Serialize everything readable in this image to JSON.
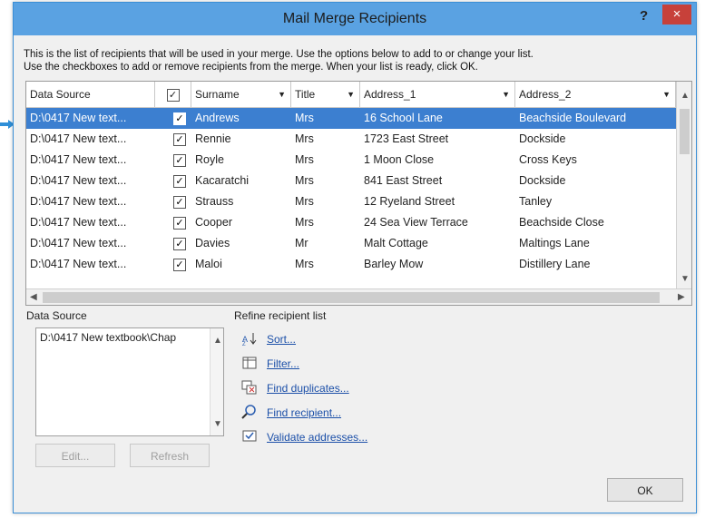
{
  "window": {
    "title": "Mail Merge Recipients",
    "help": "?",
    "close": "×"
  },
  "instructions": {
    "line1": "This is the list of recipients that will be used in your merge.  Use the options below to add to or change your list.",
    "line2": "Use the checkboxes to add or remove recipients from the merge.  When your list is ready, click OK."
  },
  "table": {
    "headers": [
      "Data Source",
      "✓",
      "Surname",
      "Title",
      "Address_1",
      "Address_2"
    ],
    "rows": [
      {
        "source": "D:\\0417 New text...",
        "checked": "✓",
        "surname": "Andrews",
        "title": "Mrs",
        "address1": "16 School Lane",
        "address2": "Beachside Boulevard",
        "selected": true
      },
      {
        "source": "D:\\0417 New text...",
        "checked": "✓",
        "surname": "Rennie",
        "title": "Mrs",
        "address1": "1723 East Street",
        "address2": "Dockside"
      },
      {
        "source": "D:\\0417 New text...",
        "checked": "✓",
        "surname": "Royle",
        "title": "Mrs",
        "address1": "1 Moon Close",
        "address2": "Cross Keys"
      },
      {
        "source": "D:\\0417 New text...",
        "checked": "✓",
        "surname": "Kacaratchi",
        "title": "Mrs",
        "address1": "841 East Street",
        "address2": "Dockside"
      },
      {
        "source": "D:\\0417 New text...",
        "checked": "✓",
        "surname": "Strauss",
        "title": "Mrs",
        "address1": "12 Ryeland Street",
        "address2": "Tanley"
      },
      {
        "source": "D:\\0417 New text...",
        "checked": "✓",
        "surname": "Cooper",
        "title": "Mrs",
        "address1": "24 Sea View Terrace",
        "address2": "Beachside Close"
      },
      {
        "source": "D:\\0417 New text...",
        "checked": "✓",
        "surname": "Davies",
        "title": "Mr",
        "address1": "Malt Cottage",
        "address2": "Maltings Lane"
      },
      {
        "source": "D:\\0417 New text...",
        "checked": "✓",
        "surname": "Maloi",
        "title": "Mrs",
        "address1": "Barley Mow",
        "address2": "Distillery Lane"
      }
    ]
  },
  "data_source": {
    "label": "Data Source",
    "value": "D:\\0417 New textbook\\Chap",
    "edit_label": "Edit...",
    "refresh_label": "Refresh"
  },
  "refine": {
    "label": "Refine recipient list",
    "items": [
      {
        "label": "Sort...",
        "icon": "sort-icon"
      },
      {
        "label": "Filter...",
        "icon": "filter-icon"
      },
      {
        "label": "Find duplicates...",
        "icon": "duplicates-icon"
      },
      {
        "label": "Find recipient...",
        "icon": "find-icon"
      },
      {
        "label": "Validate addresses...",
        "icon": "validate-icon"
      }
    ]
  },
  "ok_label": "OK",
  "colors": {
    "title_bar": "#5aa2e2",
    "selection": "#3c7fd0",
    "close": "#c7413a",
    "link": "#1b4fa8",
    "pointer": "#2f8fd8"
  }
}
